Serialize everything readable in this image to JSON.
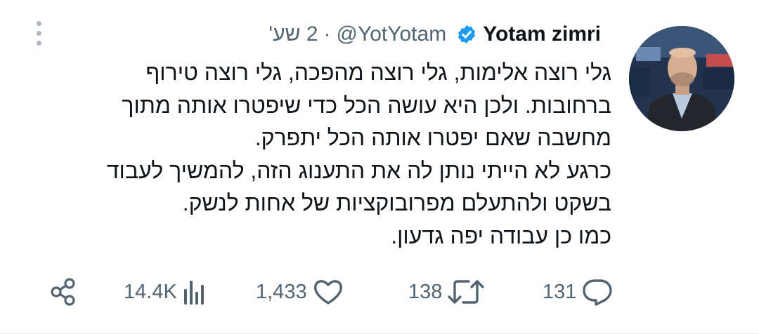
{
  "tweet": {
    "author": {
      "name": "Yotam zimri",
      "handle": "@YotYotam",
      "verified": true
    },
    "separator": "·",
    "time": "2 שע'",
    "lines": [
      "גלי רוצה אלימות, גלי רוצה מהפכה, גלי רוצה טירוף",
      "ברחובות. ולכן היא עושה הכל כדי שיפטרו אותה מתוך",
      "מחשבה שאם יפטרו אותה הכל יתפרק.",
      "כרגע לא הייתי נותן לה את התענוג הזה, להמשיך לעבוד",
      "בשקט ולהתעלם מפרובוקציות של אחות לנשק.",
      "כמו כן עבודה יפה גדעון."
    ],
    "actions": {
      "replies": "131",
      "reposts": "138",
      "likes": "1,433",
      "views": "14.4K"
    },
    "colors": {
      "verified_blue": "#1d9bf0",
      "secondary_text": "#536471",
      "primary_text": "#0f1419"
    },
    "icons": {
      "more": "more-vertical-icon",
      "reply": "reply-icon",
      "repost": "repost-icon",
      "like": "heart-icon",
      "views": "views-icon",
      "share": "share-icon"
    }
  }
}
